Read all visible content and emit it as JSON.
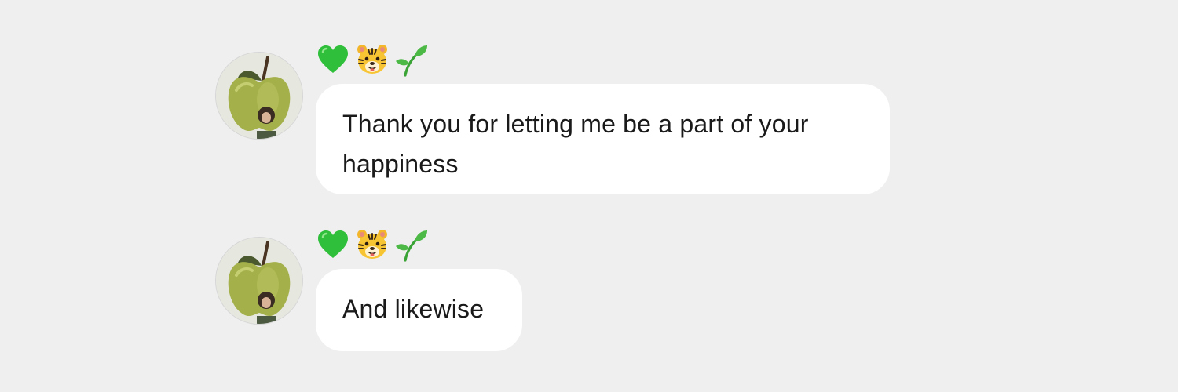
{
  "messages": [
    {
      "sender": {
        "display_name_icons": [
          "green-heart-icon",
          "tiger-face-icon",
          "seedling-icon"
        ],
        "avatar": "apple-avatar"
      },
      "text": "Thank you for letting me be a part of your happiness"
    },
    {
      "sender": {
        "display_name_icons": [
          "green-heart-icon",
          "tiger-face-icon",
          "seedling-icon"
        ],
        "avatar": "apple-avatar"
      },
      "text": "And likewise"
    }
  ],
  "colors": {
    "background": "#efefef",
    "bubble": "#ffffff",
    "text": "#1a1a1a",
    "heart": "#2fbf3a",
    "seedling": "#3aa335"
  }
}
